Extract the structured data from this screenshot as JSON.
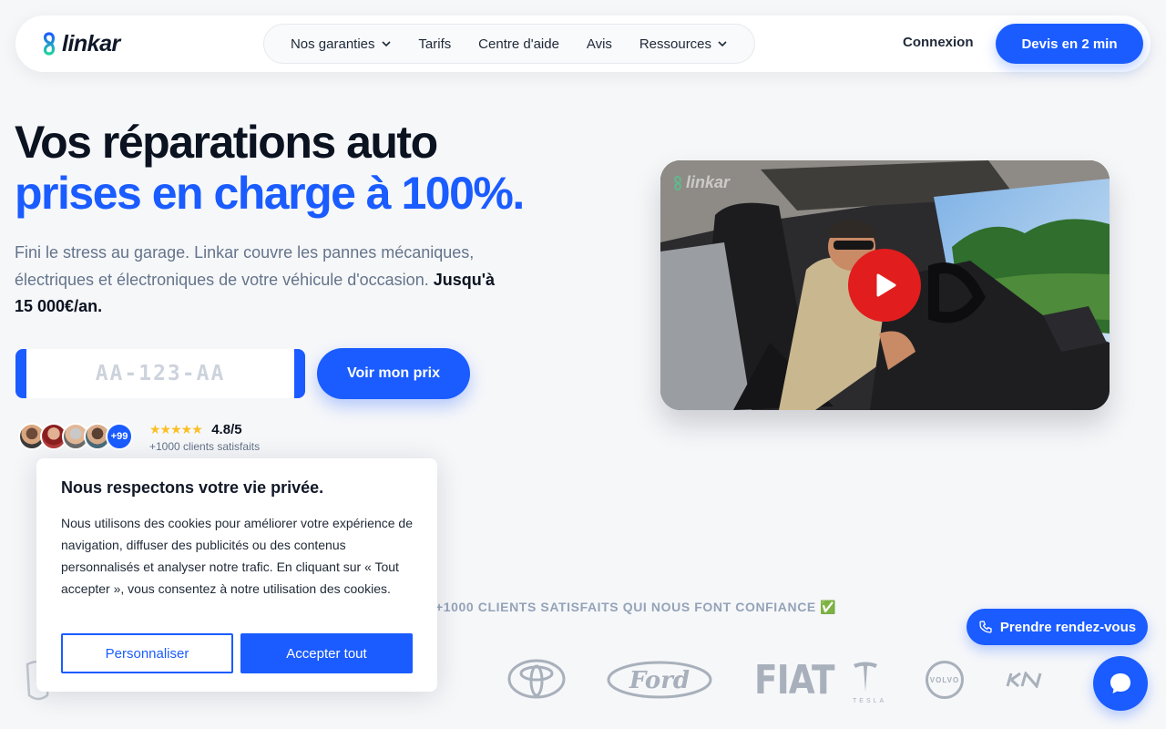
{
  "header": {
    "logo_text": "linkar",
    "nav": [
      {
        "label": "Nos garanties",
        "dropdown": true
      },
      {
        "label": "Tarifs",
        "dropdown": false
      },
      {
        "label": "Centre d'aide",
        "dropdown": false
      },
      {
        "label": "Avis",
        "dropdown": false
      },
      {
        "label": "Ressources",
        "dropdown": true
      }
    ],
    "login": "Connexion",
    "cta": "Devis en 2 min"
  },
  "hero": {
    "title_line1": "Vos réparations auto",
    "title_line2": "prises en charge à 100%.",
    "lead": "Fini le stress au garage. Linkar couvre les pannes mécaniques, électriques et électroniques de votre véhicule d'occasion. ",
    "lead_strong": "Jusqu'à 15 000€/an.",
    "plate_placeholder": "AA-123-AA",
    "price_button": "Voir mon prix",
    "avatars_more": "+99",
    "stars": "★★★★★",
    "score": "4.8/5",
    "clients": "+1000 clients satisfaits"
  },
  "video": {
    "watermark": "linkar"
  },
  "trust": {
    "label": "+1000 CLIENTS SATISFAITS QUI NOUS FONT CONFIANCE ✅",
    "brands": [
      "FIAT",
      "TESLA",
      "VOLVO"
    ]
  },
  "cookie": {
    "title": "Nous respectons votre vie privée.",
    "text": "Nous utilisons des cookies pour améliorer votre expérience de navigation, diffuser des publicités ou des contenus personnalisés et analyser notre trafic. En cliquant sur « Tout accepter », vous consentez à notre utilisation des cookies.",
    "customize": "Personnaliser",
    "accept": "Accepter tout"
  },
  "floating": {
    "appointment": "Prendre rendez-vous"
  },
  "colors": {
    "brand": "#1a5cff",
    "play": "#e11d1d",
    "stars": "#fbbf24"
  }
}
